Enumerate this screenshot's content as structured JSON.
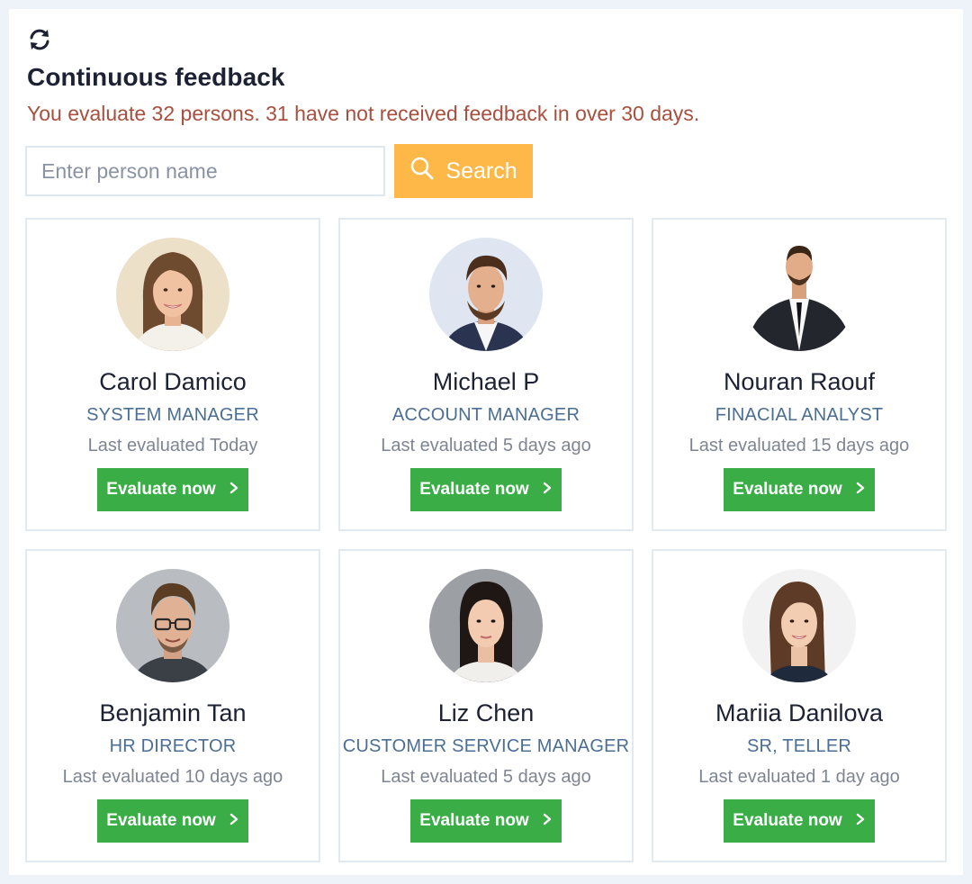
{
  "header": {
    "refresh_icon": "refresh-icon",
    "title": "Continuous feedback",
    "subtitle": "You evaluate 32 persons. 31 have not received feedback in over 30 days."
  },
  "search": {
    "placeholder": "Enter person name",
    "value": "",
    "button_label": "Search",
    "button_icon": "search-icon"
  },
  "colors": {
    "accent_search": "#fdb847",
    "evaluate_button": "#3aad47",
    "role_text": "#4a6e96",
    "subtitle_text": "#a84f3e"
  },
  "people": [
    {
      "name": "Carol Damico",
      "role": "SYSTEM MANAGER",
      "last_evaluated": "Last evaluated Today",
      "button_label": "Evaluate now"
    },
    {
      "name": "Michael P",
      "role": "ACCOUNT MANAGER",
      "last_evaluated": "Last evaluated 5 days ago",
      "button_label": "Evaluate now"
    },
    {
      "name": "Nouran Raouf",
      "role": "FINACIAL ANALYST",
      "last_evaluated": "Last evaluated 15 days ago",
      "button_label": "Evaluate now"
    },
    {
      "name": "Benjamin Tan",
      "role": "HR DIRECTOR",
      "last_evaluated": "Last evaluated 10 days ago",
      "button_label": "Evaluate now"
    },
    {
      "name": "Liz Chen",
      "role": "CUSTOMER SERVICE MANAGER",
      "last_evaluated": "Last evaluated 5 days ago",
      "button_label": "Evaluate now"
    },
    {
      "name": "Mariia Danilova",
      "role": "SR, TELLER",
      "last_evaluated": "Last evaluated 1 day ago",
      "button_label": "Evaluate now"
    }
  ]
}
